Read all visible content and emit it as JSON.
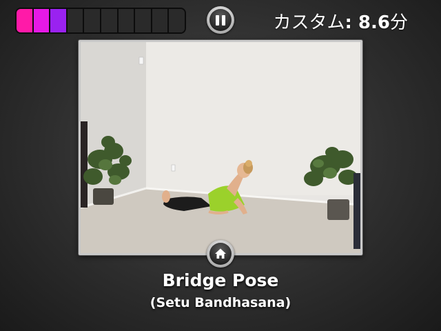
{
  "progress": {
    "total_segments": 10,
    "completed_segments": 3,
    "segment_colors": [
      "#ff1aa8",
      "#e619e6",
      "#9a22f0"
    ],
    "empty_color": "#2a2a2a"
  },
  "controls": {
    "pause_icon": "pause-icon",
    "home_icon": "home-icon"
  },
  "timer": {
    "label": "カスタム",
    "value": ": 8.6",
    "unit": "分"
  },
  "pose": {
    "name": "Bridge Pose",
    "sanskrit": "(Setu Bandhasana)"
  },
  "colors": {
    "accent_pink": "#ff1aa8",
    "accent_purple": "#9a22f0",
    "frame_border": "#c9c9c9"
  }
}
